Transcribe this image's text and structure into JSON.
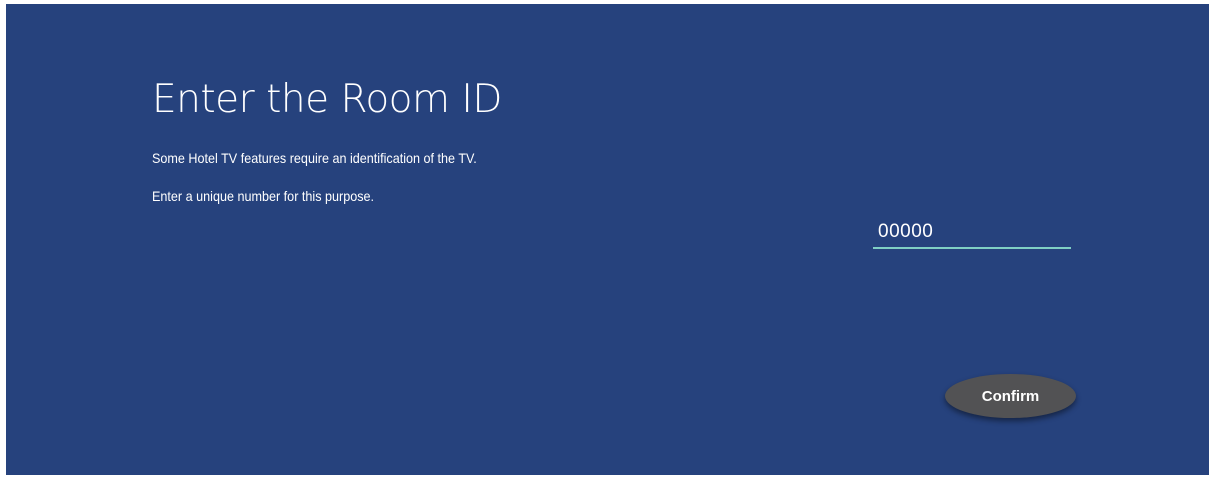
{
  "page": {
    "title": "Enter the Room ID",
    "description_line1": "Some Hotel TV features require an identification of the TV.",
    "description_line2": "Enter a unique number for this purpose."
  },
  "room_id_input": {
    "value": "00000"
  },
  "actions": {
    "confirm_label": "Confirm"
  },
  "colors": {
    "background": "#26427d",
    "input_underline": "#7fcfc4",
    "button_background": "#525254",
    "text": "#ffffff"
  }
}
